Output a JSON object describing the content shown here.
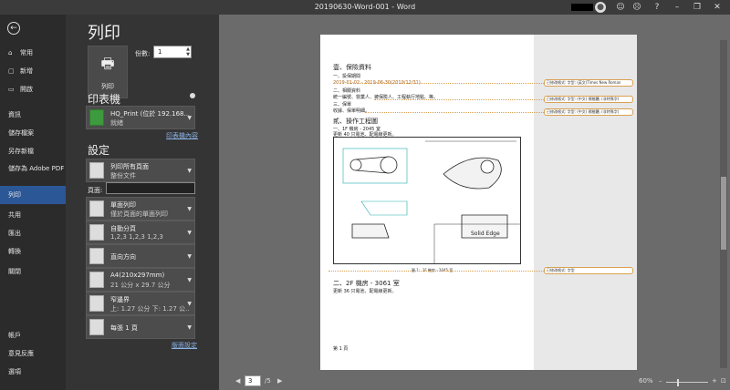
{
  "window": {
    "title": "20190630-Word-001  -  Word"
  },
  "sidebar": {
    "items": [
      {
        "label": "常用",
        "icon": "home-icon"
      },
      {
        "label": "新增",
        "icon": "new-document-icon"
      },
      {
        "label": "開啟",
        "icon": "folder-open-icon"
      },
      {
        "label": "資訊"
      },
      {
        "label": "儲存檔案"
      },
      {
        "label": "另存新檔"
      },
      {
        "label": "儲存為 Adobe PDF"
      },
      {
        "label": "列印"
      },
      {
        "label": "共用"
      },
      {
        "label": "匯出"
      },
      {
        "label": "轉換"
      },
      {
        "label": "關閉"
      },
      {
        "label": "帳戶"
      },
      {
        "label": "意見反應"
      },
      {
        "label": "選項"
      }
    ],
    "active": "列印"
  },
  "print": {
    "heading": "列印",
    "print_button": "列印",
    "copies_label": "份數:",
    "copies_value": "1",
    "printer_heading": "印表機",
    "printer_name": "HQ_Print (位於 192.168....",
    "printer_status": "就緒",
    "printer_props": "印表機內容",
    "settings_heading": "設定",
    "settings": [
      {
        "line1": "列印所有頁面",
        "line2": "整份文件"
      },
      {
        "line1": "單面列印",
        "line2": "僅於頁面的單面列印"
      },
      {
        "line1": "自動分頁",
        "line2": "1,2,3    1,2,3    1,2,3"
      },
      {
        "line1": "直向方向",
        "line2": ""
      },
      {
        "line1": "A4(210x297mm)",
        "line2": "21 公分 x 29.7 公分"
      },
      {
        "line1": "窄邊界",
        "line2": "上: 1.27 公分 下: 1.27 公..."
      },
      {
        "line1": "每張 1 頁",
        "line2": ""
      }
    ],
    "pages_label": "頁面:",
    "pages_value": "",
    "page_setup": "版面設定"
  },
  "preview": {
    "lines": [
      "壹、保險資料",
      "一、投保期間",
      "2019-01-02 - 2019-06-30(2019/12/31)",
      "二、相關資料",
      "統一編號、營業人、被保險人、工程執行地點、等。",
      "三、保單",
      "收據、保單明細。",
      "貳、操作工程圖",
      "一、1F 機房 - 2045 室",
      "更新 40 只電池、配電線更新。",
      "二、2F 機房 - 3061 室",
      "更新 36 只電池、配電線更新。",
      "第 1 頁"
    ],
    "caption": "圖 1：1F 機房 - 2045 室",
    "drawing_title": "Solid Edge",
    "comments": [
      "已修改格式: 字型: (英文)Times New Roman",
      "已修改格式: 字型: (中文) 標楷體, (非特殊字)",
      "已修改格式: 字型: (中文) 標楷體, (非特殊字)",
      "已修改格式: 字型"
    ]
  },
  "footer": {
    "page_current": "3",
    "page_total": "/5",
    "zoom": "60%"
  }
}
